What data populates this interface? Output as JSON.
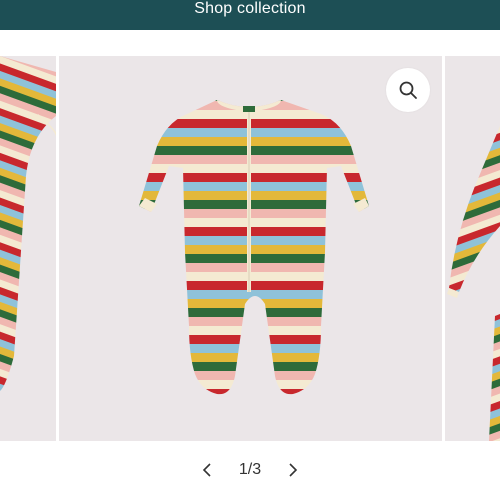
{
  "header": {
    "shop_collection_label": "Shop collection",
    "background_color": "#1d4f55"
  },
  "gallery": {
    "slide_background": "#ebe6e8",
    "product_image_alt": "rainbow-striped footed baby sleepsuit",
    "stripe_colors": [
      "#c8282d",
      "#8fc2d9",
      "#e3b83a",
      "#2e6b3a",
      "#f0b7b0",
      "#f4ead2"
    ],
    "zoom_icon": "search-icon",
    "current_index": "1",
    "separator": "/",
    "total": "3",
    "prev_icon": "chevron-left-icon",
    "next_icon": "chevron-right-icon"
  }
}
